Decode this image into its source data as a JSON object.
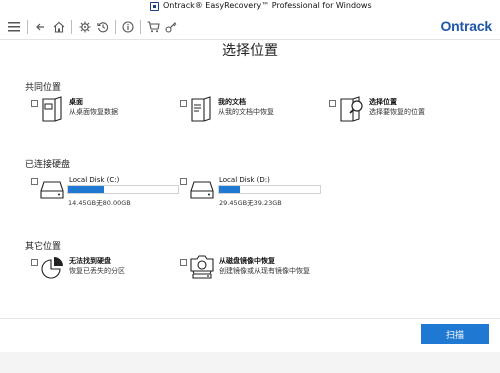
{
  "window": {
    "title": "Ontrack® EasyRecovery™ Professional for Windows"
  },
  "toolbar": {
    "brand": "Ontrack"
  },
  "page": {
    "title": "选择位置"
  },
  "sections": {
    "common": {
      "title": "共同位置",
      "items": [
        {
          "title": "桌面",
          "desc": "从桌面恢复数据"
        },
        {
          "title": "我的文档",
          "desc": "从我的文档中恢复"
        },
        {
          "title": "选择位置",
          "desc": "选择要恢复的位置"
        }
      ]
    },
    "disks": {
      "title": "已连接硬盘",
      "items": [
        {
          "name": "Local Disk (C:)",
          "size": "14.45GB无80.00GB",
          "used_fraction": 0.33
        },
        {
          "name": "Local Disk (D:)",
          "size": "29.45GB无39.23GB",
          "used_fraction": 0.21
        }
      ]
    },
    "other": {
      "title": "其它位置",
      "items": [
        {
          "title": "无法找到硬盘",
          "desc": "恢复已丢失的分区"
        },
        {
          "title": "从磁盘镜像中恢复",
          "desc": "创建镜像或从现有镜像中恢复"
        }
      ]
    }
  },
  "footer": {
    "scan_label": "扫描"
  },
  "colors": {
    "accent": "#1f78d1",
    "brand": "#1f56a8"
  }
}
